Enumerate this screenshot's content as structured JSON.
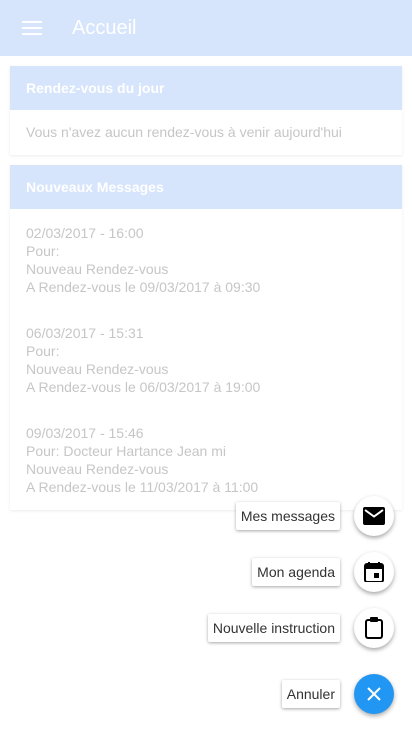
{
  "appbar": {
    "title": "Accueil",
    "menu_icon": "menu-icon"
  },
  "appointments_card": {
    "title": "Rendez-vous du jour",
    "empty_text": "Vous n'avez aucun rendez-vous à venir aujourd'hui"
  },
  "messages_card": {
    "title": "Nouveaux Messages",
    "messages": [
      {
        "date": "02/03/2017 - 16:00",
        "recipient": "Pour:",
        "subject": "Nouveau Rendez-vous",
        "body": "A Rendez-vous le 09/03/2017 à 09:30"
      },
      {
        "date": "06/03/2017 - 15:31",
        "recipient": "Pour:",
        "subject": "Nouveau Rendez-vous",
        "body": "A Rendez-vous le 06/03/2017 à 19:00"
      },
      {
        "date": "09/03/2017 - 15:46",
        "recipient": "Pour: Docteur Hartance Jean mi",
        "subject": "Nouveau Rendez-vous",
        "body": "A Rendez-vous le 11/03/2017 à 11:00"
      }
    ]
  },
  "fab_menu": {
    "messages_label": "Mes messages",
    "agenda_label": "Mon agenda",
    "instruction_label": "Nouvelle instruction",
    "cancel_label": "Annuler"
  },
  "colors": {
    "accent": "#2196f3",
    "header_bg": "#d6e4fc",
    "muted_text": "#c6c6c6"
  }
}
